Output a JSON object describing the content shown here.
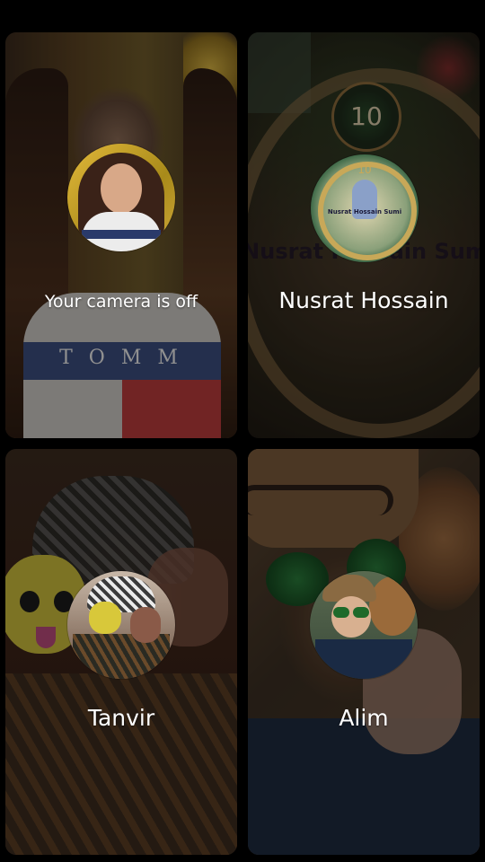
{
  "tiles": [
    {
      "label": "Your camera is off"
    },
    {
      "label": "Nusrat Hossain",
      "background_text": "Nusrat Hossain Sum",
      "badge_number": "10",
      "avatar_caption": "Nusrat Hossain Sumi"
    },
    {
      "label": "Tanvir"
    },
    {
      "label": "Alim"
    }
  ],
  "tile1_shirt_text": "TOMM"
}
